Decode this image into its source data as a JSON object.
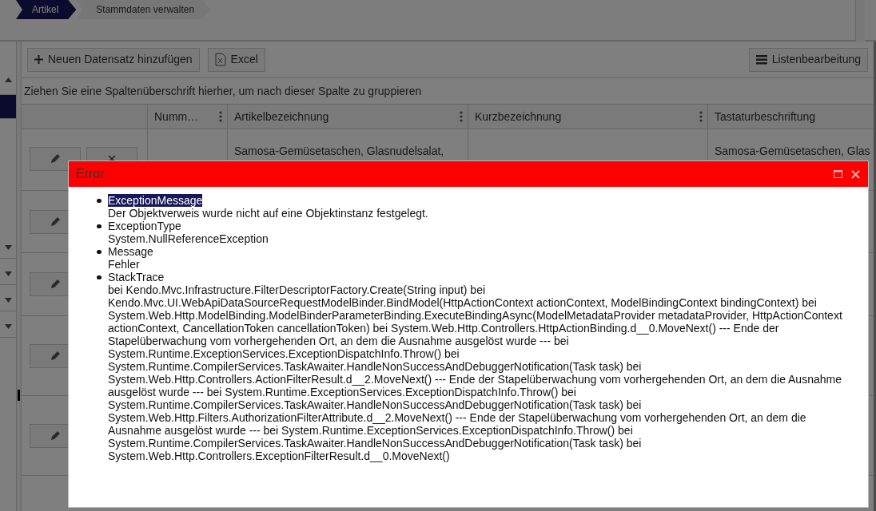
{
  "breadcrumb": [
    {
      "label": "Artikel",
      "selected": true
    },
    {
      "label": "Stammdaten verwalten",
      "selected": false
    }
  ],
  "sidebar": {
    "items": [
      {
        "kind": "collapse",
        "selected": false
      },
      {
        "kind": "entry",
        "selected": true
      },
      {
        "kind": "expand",
        "selected": false
      },
      {
        "kind": "expand",
        "selected": false
      },
      {
        "kind": "expand",
        "selected": false
      },
      {
        "kind": "expand",
        "selected": false
      }
    ]
  },
  "toolbar": {
    "buttons": [
      {
        "kind": "add",
        "label": "Neuen Datensatz hinzufügen"
      },
      {
        "kind": "excel",
        "label": "Excel"
      },
      {
        "kind": "list",
        "label": "Listenbearbeitung"
      }
    ]
  },
  "group_panel": {
    "text": "Ziehen Sie eine Spaltenüberschrift hierher, um nach dieser Spalte zu gruppieren"
  },
  "grid": {
    "columns": [
      {
        "label": "Numm…",
        "menu": true
      },
      {
        "label": "Artikelbezeichnung",
        "menu": true
      },
      {
        "label": "Kurzbezeichnung",
        "menu": true
      },
      {
        "label": "Tastaturbeschriftung",
        "menu": false
      }
    ],
    "rows": [
      {
        "actions": [
          {
            "kind": "edit"
          },
          {
            "kind": "delete"
          }
        ],
        "artikelbezeichnung": "Samosa-Gemüsetaschen, Glasnudelsalat,",
        "tastaturbeschriftung": "Samosa-Gemüsetaschen, Glas"
      },
      {
        "actions": [
          {
            "kind": "edit"
          }
        ]
      },
      {
        "actions": [
          {
            "kind": "edit"
          }
        ]
      },
      {
        "actions": [
          {
            "kind": "edit"
          }
        ]
      },
      {
        "actions": [
          {
            "kind": "edit"
          }
        ]
      }
    ]
  },
  "dialog": {
    "title": "Error",
    "items": [
      {
        "label": "ExceptionMessage",
        "highlighted": true,
        "value": "Der Objektverweis wurde nicht auf eine Objektinstanz festgelegt."
      },
      {
        "label": "ExceptionType",
        "highlighted": false,
        "value": "System.NullReferenceException"
      },
      {
        "label": "Message",
        "highlighted": false,
        "value": "Fehler"
      },
      {
        "label": "StackTrace",
        "highlighted": false,
        "value": "bei Kendo.Mvc.Infrastructure.FilterDescriptorFactory.Create(String input) bei Kendo.Mvc.UI.WebApiDataSourceRequestModelBinder.BindModel(HttpActionContext actionContext, ModelBindingContext bindingContext) bei System.Web.Http.ModelBinding.ModelBinderParameterBinding.ExecuteBindingAsync(ModelMetadataProvider metadataProvider, HttpActionContext actionContext, CancellationToken cancellationToken) bei System.Web.Http.Controllers.HttpActionBinding.d__0.MoveNext() --- Ende der Stapelüberwachung vom vorhergehenden Ort, an dem die Ausnahme ausgelöst wurde --- bei System.Runtime.ExceptionServices.ExceptionDispatchInfo.Throw() bei System.Runtime.CompilerServices.TaskAwaiter.HandleNonSuccessAndDebuggerNotification(Task task) bei System.Web.Http.Controllers.ActionFilterResult.d__2.MoveNext() --- Ende der Stapelüberwachung vom vorhergehenden Ort, an dem die Ausnahme ausgelöst wurde --- bei System.Runtime.ExceptionServices.ExceptionDispatchInfo.Throw() bei System.Runtime.CompilerServices.TaskAwaiter.HandleNonSuccessAndDebuggerNotification(Task task) bei System.Web.Http.Filters.AuthorizationFilterAttribute.d__2.MoveNext() --- Ende der Stapelüberwachung vom vorhergehenden Ort, an dem die Ausnahme ausgelöst wurde --- bei System.Runtime.ExceptionServices.ExceptionDispatchInfo.Throw() bei System.Runtime.CompilerServices.TaskAwaiter.HandleNonSuccessAndDebuggerNotification(Task task) bei System.Web.Http.Controllers.ExceptionFilterResult.d__0.MoveNext()"
      }
    ]
  }
}
